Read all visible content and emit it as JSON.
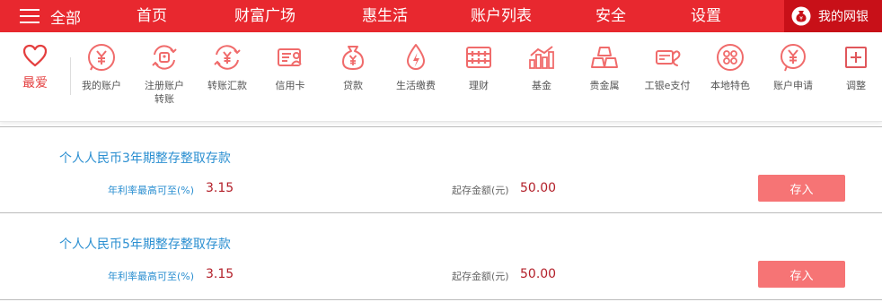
{
  "colors": {
    "nav_red": "#e8282f",
    "mybank_red": "#c81018",
    "icon_red": "#f06b6b",
    "link_blue": "#2b8fd1",
    "value_red": "#b3202a",
    "button_pink": "#f67475"
  },
  "topnav": {
    "all_label": "全部",
    "items": [
      "首页",
      "财富广场",
      "惠生活",
      "账户列表",
      "安全",
      "设置"
    ],
    "mybank_label": "我的网银"
  },
  "quickbar": {
    "fav_label": "最爱",
    "items": [
      {
        "label": "我的账户",
        "icon": "yen-coin-icon"
      },
      {
        "label": "注册账户转账",
        "icon": "account-transfer-icon"
      },
      {
        "label": "转账汇款",
        "icon": "yen-transfer-icon"
      },
      {
        "label": "信用卡",
        "icon": "credit-card-icon"
      },
      {
        "label": "贷款",
        "icon": "money-bag-icon"
      },
      {
        "label": "生活缴费",
        "icon": "utility-drop-icon"
      },
      {
        "label": "理财",
        "icon": "abacus-icon"
      },
      {
        "label": "基金",
        "icon": "fund-chart-icon"
      },
      {
        "label": "贵金属",
        "icon": "gold-bars-icon"
      },
      {
        "label": "工银e支付",
        "icon": "e-pay-icon"
      },
      {
        "label": "本地特色",
        "icon": "local-feature-icon"
      },
      {
        "label": "账户申请",
        "icon": "account-apply-icon"
      },
      {
        "label": "调整",
        "icon": "adjust-plus-icon"
      }
    ]
  },
  "products": [
    {
      "name": "个人人民币3年期整存整取存款",
      "rate_label": "年利率最高可至(%)",
      "rate": "3.15",
      "min_label": "起存金额(元)",
      "min": "50.00",
      "button": "存入"
    },
    {
      "name": "个人人民币5年期整存整取存款",
      "rate_label": "年利率最高可至(%)",
      "rate": "3.15",
      "min_label": "起存金额(元)",
      "min": "50.00",
      "button": "存入"
    }
  ]
}
